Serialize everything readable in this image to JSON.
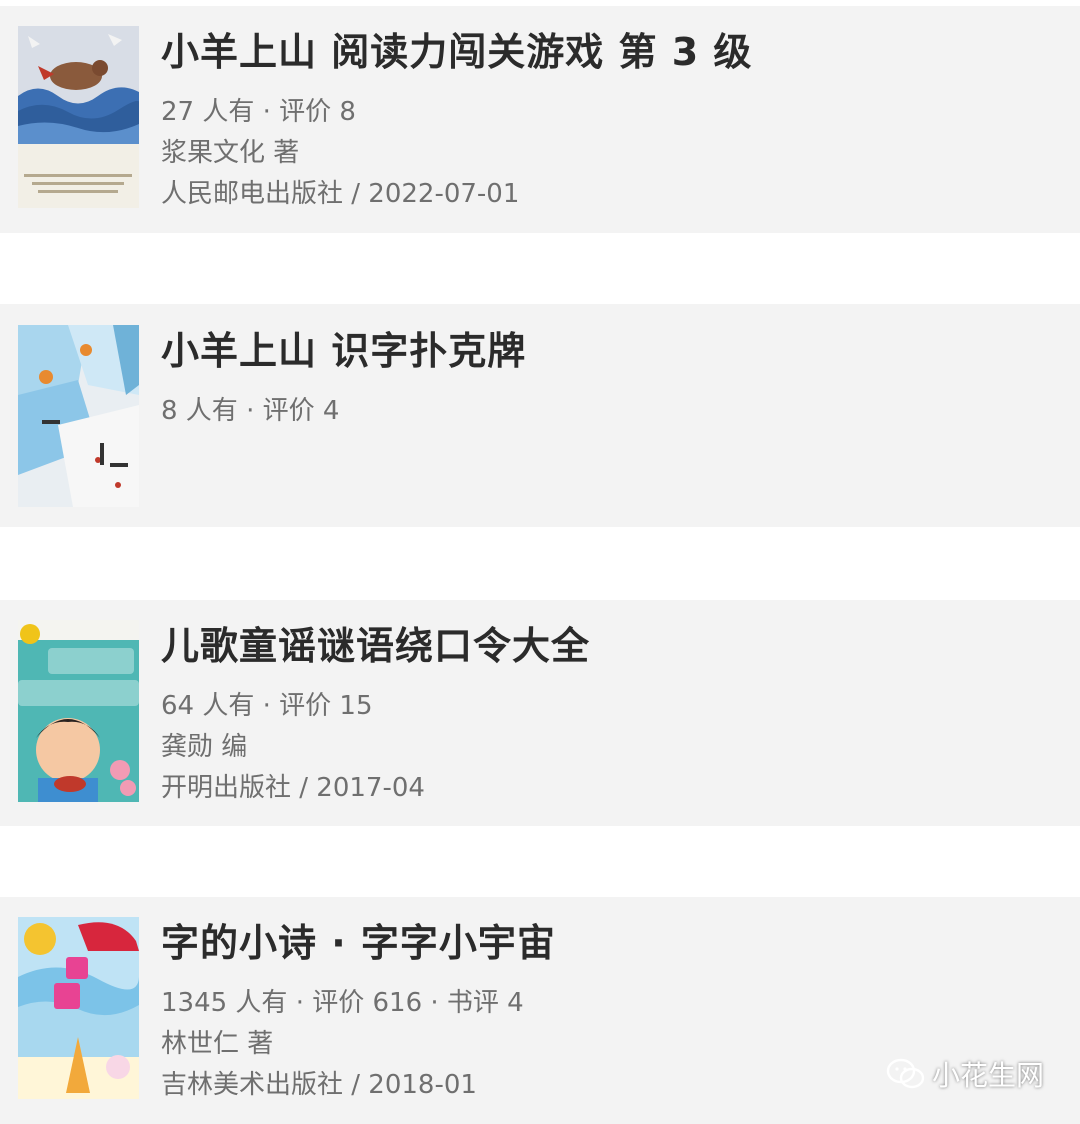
{
  "books": [
    {
      "title": "小羊上山 阅读力闯关游戏 第 3 级",
      "stats": "27 人有 · 评价 8",
      "author": "浆果文化 著",
      "publisher": "人民邮电出版社 / 2022-07-01",
      "cover_icon": "book-cover-reading-game"
    },
    {
      "title": "小羊上山 识字扑克牌",
      "stats": "8 人有 · 评价 4",
      "cover_icon": "book-cover-poker-cards"
    },
    {
      "title": "儿歌童谣谜语绕口令大全",
      "stats": "64 人有 · 评价 15",
      "author": "龚勋 编",
      "publisher": "开明出版社 / 2017-04",
      "cover_icon": "book-cover-nursery-rhymes"
    },
    {
      "title": "字的小诗 · 字字小宇宙",
      "stats": "1345 人有 · 评价 616 · 书评 4",
      "author": "林世仁 著",
      "publisher": "吉林美术出版社 / 2018-01",
      "cover_icon": "book-cover-word-poems"
    }
  ],
  "watermark": {
    "label": "小花生网",
    "icon": "wechat-icon"
  },
  "colors": {
    "card_background": "#f3f3f3",
    "title_text": "#2b2b2b",
    "meta_text": "#6f6f6f"
  }
}
